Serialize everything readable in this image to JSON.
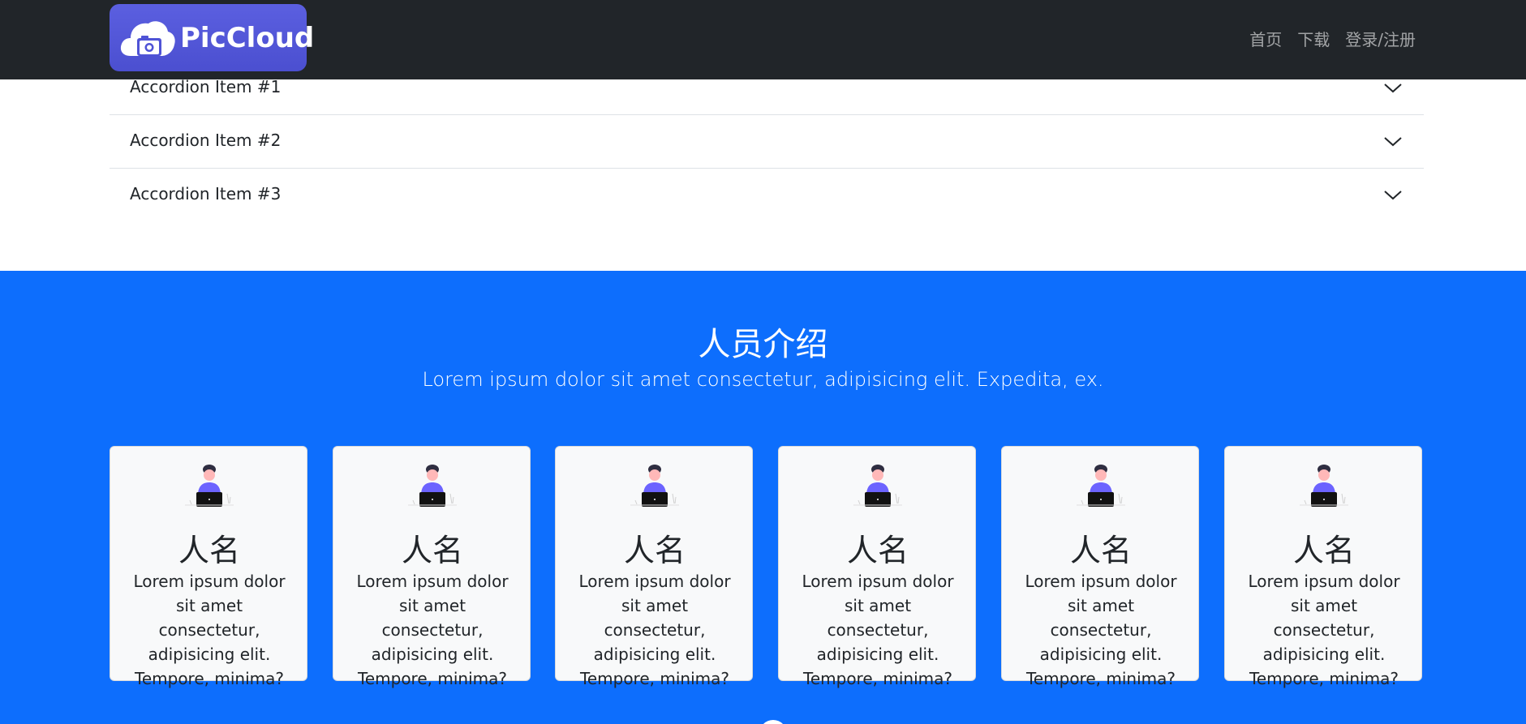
{
  "navbar": {
    "brand": "PicCloud",
    "links": [
      "首页",
      "下载",
      "登录/注册"
    ]
  },
  "accordion": {
    "items": [
      "Accordion Item #1",
      "Accordion Item #2",
      "Accordion Item #3"
    ]
  },
  "team": {
    "title": "人员介绍",
    "subtitle": "Lorem ipsum dolor sit amet consectetur, adipisicing elit. Expedita, ex.",
    "members": [
      {
        "name": "人名",
        "bio": "Lorem ipsum dolor sit amet consectetur, adipisicing elit. Tempore, minima?"
      },
      {
        "name": "人名",
        "bio": "Lorem ipsum dolor sit amet consectetur, adipisicing elit. Tempore, minima?"
      },
      {
        "name": "人名",
        "bio": "Lorem ipsum dolor sit amet consectetur, adipisicing elit. Tempore, minima?"
      },
      {
        "name": "人名",
        "bio": "Lorem ipsum dolor sit amet consectetur, adipisicing elit. Tempore, minima?"
      },
      {
        "name": "人名",
        "bio": "Lorem ipsum dolor sit amet consectetur, adipisicing elit. Tempore, minima?"
      },
      {
        "name": "人名",
        "bio": "Lorem ipsum dolor sit amet consectetur, adipisicing elit. Tempore, minima?"
      }
    ]
  },
  "colors": {
    "navbar_bg": "#212529",
    "brand_bg": "#4f53d6",
    "section_bg": "#0d6efd",
    "card_bg": "#f8f9fa",
    "avatar_shirt": "#6c63ff"
  },
  "icons": {
    "brand": "cloud-camera-icon",
    "accordion": "chevron-down-icon",
    "avatar": "person-with-laptop-icon"
  }
}
